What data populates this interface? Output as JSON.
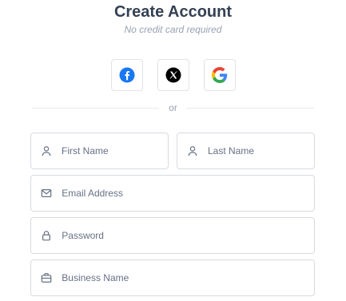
{
  "header": {
    "title": "Create Account",
    "subtitle": "No credit card required"
  },
  "social": {
    "buttons": [
      {
        "icon": "facebook-icon",
        "color": "#1877F2"
      },
      {
        "icon": "x-icon",
        "color": "#000000"
      },
      {
        "icon": "google-icon",
        "color": "#4285F4"
      }
    ]
  },
  "divider": {
    "text": "or"
  },
  "form": {
    "first_name": {
      "placeholder": "First Name",
      "value": "",
      "icon": "user-icon"
    },
    "last_name": {
      "placeholder": "Last Name",
      "value": "",
      "icon": "user-icon"
    },
    "email": {
      "placeholder": "Email Address",
      "value": "",
      "icon": "mail-icon"
    },
    "password": {
      "placeholder": "Password",
      "value": "",
      "icon": "lock-icon"
    },
    "business": {
      "placeholder": "Business Name",
      "value": "",
      "icon": "briefcase-icon"
    }
  },
  "colors": {
    "title": "#344054",
    "muted": "#98a2b3",
    "border": "#d7dbe1"
  }
}
